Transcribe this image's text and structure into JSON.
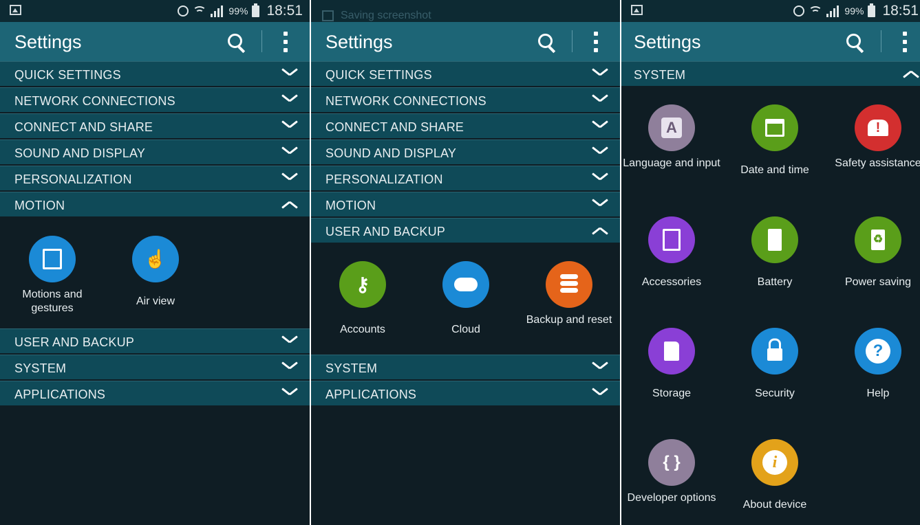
{
  "status_bar": {
    "battery_pct": "99%",
    "time": "18:51"
  },
  "panel2_notification": "Saving screenshot",
  "app_bar": {
    "title": "Settings"
  },
  "colors": {
    "appbar": "#1d6576",
    "section_header": "#0f4a58",
    "background": "#0f1d24",
    "motion_blue": "#1b8ad6",
    "accounts_green": "#5a9e1a",
    "backup_orange": "#e5641a",
    "lang_gray": "#8f7f9b",
    "safety_red": "#d32f2f",
    "accessories_purple": "#8a3fd6",
    "about_yellow": "#e3a21a"
  },
  "panel1": {
    "sections_top": [
      {
        "label": "QUICK SETTINGS"
      },
      {
        "label": "NETWORK CONNECTIONS"
      },
      {
        "label": "CONNECT AND SHARE"
      },
      {
        "label": "SOUND AND DISPLAY"
      },
      {
        "label": "PERSONALIZATION"
      },
      {
        "label": "MOTION"
      }
    ],
    "motion_items": [
      {
        "label": "Motions and gestures",
        "icon": "motions-icon"
      },
      {
        "label": "Air view",
        "icon": "air-view-icon"
      }
    ],
    "sections_bottom": [
      {
        "label": "USER AND BACKUP"
      },
      {
        "label": "SYSTEM"
      },
      {
        "label": "APPLICATIONS"
      }
    ]
  },
  "panel2": {
    "sections_top": [
      {
        "label": "QUICK SETTINGS"
      },
      {
        "label": "NETWORK CONNECTIONS"
      },
      {
        "label": "CONNECT AND SHARE"
      },
      {
        "label": "SOUND AND DISPLAY"
      },
      {
        "label": "PERSONALIZATION"
      },
      {
        "label": "MOTION"
      },
      {
        "label": "USER AND BACKUP"
      }
    ],
    "backup_items": [
      {
        "label": "Accounts",
        "icon": "key-icon"
      },
      {
        "label": "Cloud",
        "icon": "cloud-sync-icon"
      },
      {
        "label": "Backup and reset",
        "icon": "database-reset-icon"
      }
    ],
    "sections_bottom": [
      {
        "label": "SYSTEM"
      },
      {
        "label": "APPLICATIONS"
      }
    ]
  },
  "panel3": {
    "section": {
      "label": "SYSTEM"
    },
    "system_items": [
      {
        "label": "Language and input",
        "icon": "letter-a-icon",
        "glyph": "A"
      },
      {
        "label": "Date and time",
        "icon": "calendar-clock-icon"
      },
      {
        "label": "Safety assistance",
        "icon": "alert-icon",
        "glyph": "!"
      },
      {
        "label": "Accessories",
        "icon": "accessories-icon"
      },
      {
        "label": "Battery",
        "icon": "battery-icon"
      },
      {
        "label": "Power saving",
        "icon": "recycle-battery-icon"
      },
      {
        "label": "Storage",
        "icon": "sd-card-icon"
      },
      {
        "label": "Security",
        "icon": "lock-icon"
      },
      {
        "label": "Help",
        "icon": "question-icon",
        "glyph": "?"
      },
      {
        "label": "Developer options",
        "icon": "braces-icon",
        "glyph": "{ }"
      },
      {
        "label": "About device",
        "icon": "info-icon",
        "glyph": "i"
      }
    ]
  }
}
